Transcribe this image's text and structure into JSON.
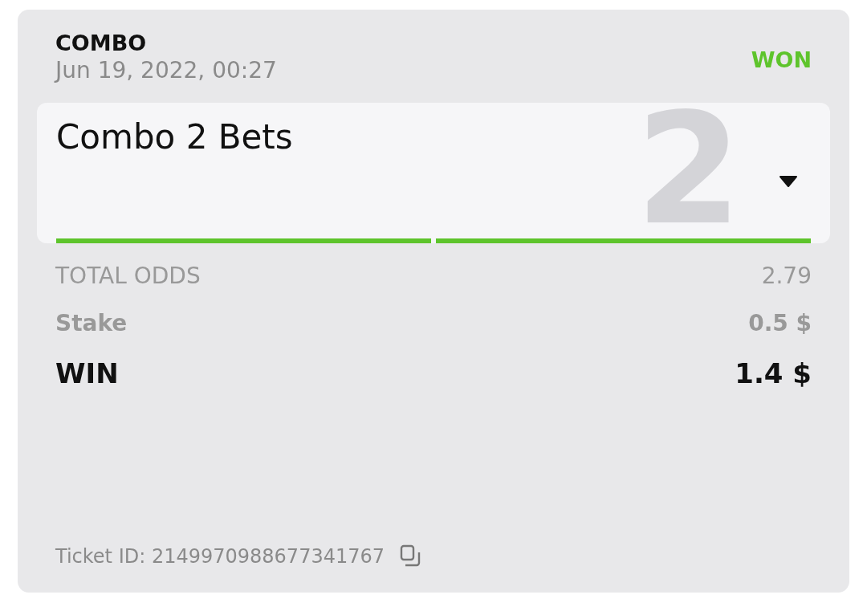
{
  "bet": {
    "type": "COMBO",
    "date": "Jun 19, 2022, 00:27",
    "status": {
      "label": "WON",
      "kind": "won"
    }
  },
  "panel": {
    "title": "Combo 2 Bets",
    "count": "2",
    "expanded": false,
    "legs": [
      {
        "won": true
      },
      {
        "won": true
      }
    ]
  },
  "totals": [
    {
      "label": "TOTAL ODDS",
      "value": "2.79",
      "kind": "odds"
    },
    {
      "label": "Stake",
      "value": "0.5 $",
      "kind": "stake"
    },
    {
      "label": "WIN",
      "value": "1.4 $",
      "kind": "win"
    }
  ],
  "ticket": {
    "label": "Ticket ID: 2149970988677341767"
  }
}
